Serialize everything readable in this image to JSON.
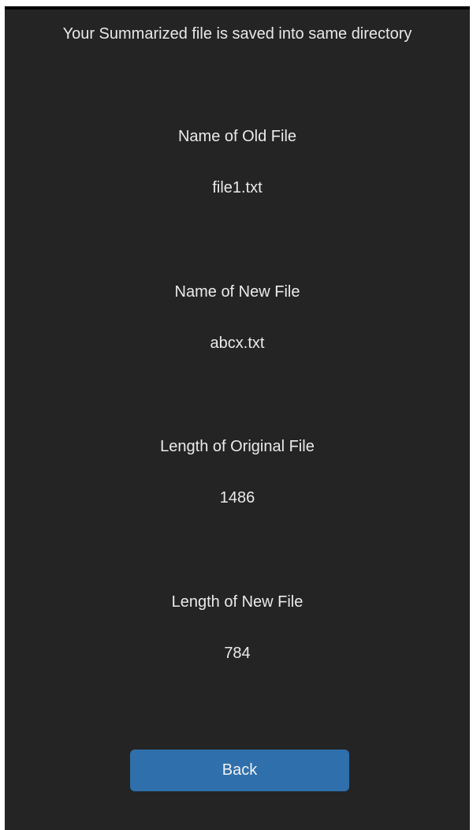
{
  "header": {
    "message": "Your Summarized file is saved into same directory"
  },
  "details": [
    {
      "label": "Name of Old File",
      "value": "file1.txt"
    },
    {
      "label": "Name of New File",
      "value": "abcx.txt"
    },
    {
      "label": "Length of Original File",
      "value": "1486"
    },
    {
      "label": "Length of New File",
      "value": "784"
    }
  ],
  "actions": {
    "back_label": "Back"
  },
  "colors": {
    "background": "#242424",
    "text": "#eaeaea",
    "button": "#2f6fab"
  }
}
